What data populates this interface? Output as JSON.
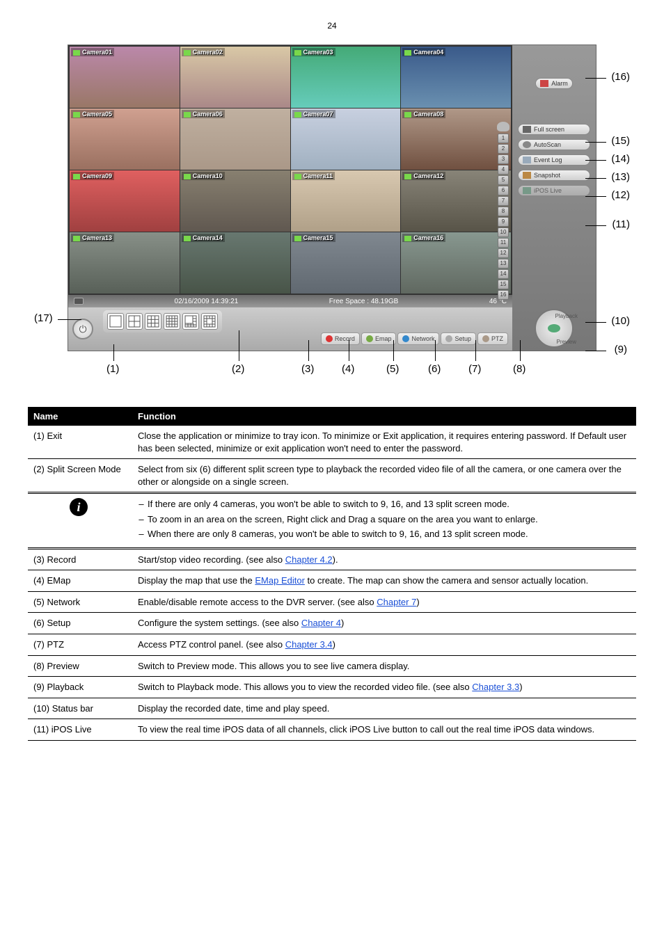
{
  "page_number": "24",
  "figure": {
    "cameras": [
      "Camera01",
      "Camera02",
      "Camera03",
      "Camera04",
      "Camera05",
      "Camera06",
      "Camera07",
      "Camera08",
      "Camera09",
      "Camera10",
      "Camera11",
      "Camera12",
      "Camera13",
      "Camera14",
      "Camera15",
      "Camera16"
    ],
    "status": {
      "datetime": "02/16/2009  14:39:21",
      "free_space_label": "Free Space",
      "free_space_value": ": 48.19GB",
      "temp": "46",
      "temp_unit": "°C"
    },
    "channel_numbers": [
      "1",
      "2",
      "3",
      "4",
      "5",
      "6",
      "7",
      "8",
      "9",
      "10",
      "11",
      "12",
      "13",
      "14",
      "15",
      "16"
    ],
    "main_buttons": {
      "record": "Record",
      "emap": "Emap",
      "network": "Network",
      "setup": "Setup",
      "ptz": "PTZ"
    },
    "side_buttons": {
      "alarm": "Alarm",
      "full_screen": "Full screen",
      "autoscan": "AutoScan",
      "event_log": "Event Log",
      "snapshot": "Snapshot",
      "iposlive": "iPOS Live"
    },
    "dial": {
      "playback": "Playback",
      "preview": "Preview"
    }
  },
  "callouts": {
    "c1": "(1)",
    "c2": "(2)",
    "c3": "(3)",
    "c4": "(4)",
    "c5": "(5)",
    "c6": "(6)",
    "c7": "(7)",
    "c8": "(8)",
    "c9": "(9)",
    "c10": "(10)",
    "c11": "(11)",
    "c12": "(12)",
    "c13": "(13)",
    "c14": "(14)",
    "c15": "(15)",
    "c16": "(16)",
    "c17": "(17)"
  },
  "header": {
    "name": "Name",
    "func": "Function"
  },
  "rows": {
    "r1_name": "(1) Exit",
    "r1_func": "Close the application or minimize to tray icon. To minimize or Exit application, it requires entering password. If Default user has been selected, minimize or exit application won't need to enter the password.",
    "r2_name": "(2) Split Screen Mode",
    "r2_func": "Select from six (6) different split screen type to playback the recorded video file of all the camera, or one camera over the other or alongside on a single screen.",
    "info": {
      "l1": "If there are only 4 cameras, you won't be able to switch to 9, 16, and 13 split screen mode.",
      "l2": "To zoom in an area on the screen, Right click and Drag a square on the area you want to enlarge.",
      "l3a": "When there are only 8 ",
      "l3b": "cameras, you won't be able to switch to",
      "l3c": " 9, 16, and 13 split screen mode."
    },
    "r3_name": "(3) Record",
    "r3_func_a": "Start/stop video recording. (see also ",
    "r3_link": "Chapter 4.2",
    "r3_func_b": ").",
    "r4_name": "(4) EMap",
    "r4_func_a": "Display the map that use the ",
    "r4_link": "EMap Editor",
    "r4_func_b": " to create. The map can show the camera and sensor actually location.",
    "r5_name": "(5) Network",
    "r5_func_a": "Enable/disable remote access to the DVR server. (see also ",
    "r5_link": "Chapter 7",
    "r5_func_b": ")",
    "r6_name": "(6) Setup",
    "r6_func_a": "Configure the system settings. (see also ",
    "r6_link": "Chapter 4",
    "r6_func_b": ")",
    "r7_name": "(7) PTZ",
    "r7_func_a": "Access PTZ control panel. (see also ",
    "r7_link": "Chapter 3.4",
    "r7_func_b": ")",
    "r8_name": "(8) Preview",
    "r8_func": "Switch to Preview mode. This allows you to see live camera display.",
    "r9_name": "(9) Playback",
    "r9_func_a": "Switch to Playback mode. This allows you to view the recorded video file. (see also ",
    "r9_link": "Chapter 3.3",
    "r9_func_b": ")",
    "r10_name": "(10) Status bar",
    "r10_func": "Display the recorded date, time and play speed.",
    "r11_name": "(11) iPOS Live",
    "r11_func": "To view the real time iPOS data of all channels, click iPOS Live button to call out the real time iPOS data windows."
  }
}
